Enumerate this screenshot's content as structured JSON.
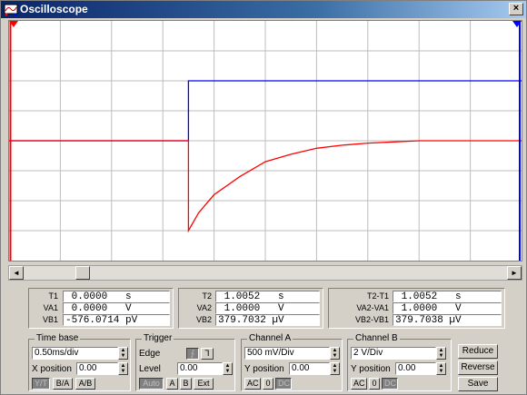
{
  "window": {
    "title": "Oscilloscope",
    "close_glyph": "×",
    "accent_title": "#0a246a"
  },
  "scrollbar": {
    "left_glyph": "◄",
    "right_glyph": "►",
    "position_fraction": 0.11
  },
  "readout": {
    "col1": [
      {
        "label": "T1",
        "value": " 0.0000   s"
      },
      {
        "label": "VA1",
        "value": " 0.0000   V"
      },
      {
        "label": "VB1",
        "value": "-576.0714 pV"
      }
    ],
    "col2": [
      {
        "label": "T2",
        "value": " 1.0052   s"
      },
      {
        "label": "VA2",
        "value": " 1.0000   V"
      },
      {
        "label": "VB2",
        "value": "379.7032 µV"
      }
    ],
    "col3": [
      {
        "label": "T2-T1",
        "value": " 1.0052   s"
      },
      {
        "label": "VA2-VA1",
        "value": " 1.0000   V"
      },
      {
        "label": "VB2-VB1",
        "value": "379.7038 µV"
      }
    ]
  },
  "timebase": {
    "title": "Time base",
    "scale": "0.50ms/div",
    "xpos_label": "X position",
    "xpos": "0.00",
    "modes": [
      "Y/T",
      "B/A",
      "A/B"
    ]
  },
  "trigger": {
    "title": "Trigger",
    "edge_label": "Edge",
    "level_label": "Level",
    "level": "0.00",
    "sources": [
      "Auto",
      "A",
      "B",
      "Ext"
    ],
    "edge_rise": "⨍",
    "edge_fall": "Ꞁ"
  },
  "channel_a": {
    "title": "Channel A",
    "scale": "500 mV/Div",
    "ypos_label": "Y position",
    "ypos": "0.00",
    "coupling": [
      "AC",
      "0",
      "DC"
    ]
  },
  "channel_b": {
    "title": "Channel B",
    "scale": "2  V/Div",
    "ypos_label": "Y position",
    "ypos": "0.00",
    "coupling": [
      "AC",
      "0",
      "DC"
    ]
  },
  "buttons": {
    "reduce": "Reduce",
    "reverse": "Reverse",
    "save": "Save"
  },
  "chart_data": {
    "type": "line",
    "grid": true,
    "divisions": {
      "x": 10,
      "y": 8
    },
    "series": [
      {
        "color": "#0000ff",
        "points": [
          [
            0,
            4
          ],
          [
            3.5,
            4
          ],
          [
            3.5,
            6.0
          ],
          [
            10,
            6.0
          ]
        ]
      },
      {
        "color": "#ff0000",
        "points": [
          [
            0,
            4
          ],
          [
            3.5,
            4
          ],
          [
            3.5,
            1.0
          ],
          [
            3.7,
            1.6
          ],
          [
            4,
            2.2
          ],
          [
            4.5,
            2.8
          ],
          [
            5,
            3.3
          ],
          [
            5.5,
            3.55
          ],
          [
            6,
            3.75
          ],
          [
            6.5,
            3.85
          ],
          [
            7,
            3.92
          ],
          [
            7.5,
            3.96
          ],
          [
            8,
            4
          ],
          [
            10,
            4
          ]
        ]
      }
    ],
    "cursor_colors": [
      "#ff0000",
      "#0000ff"
    ]
  }
}
